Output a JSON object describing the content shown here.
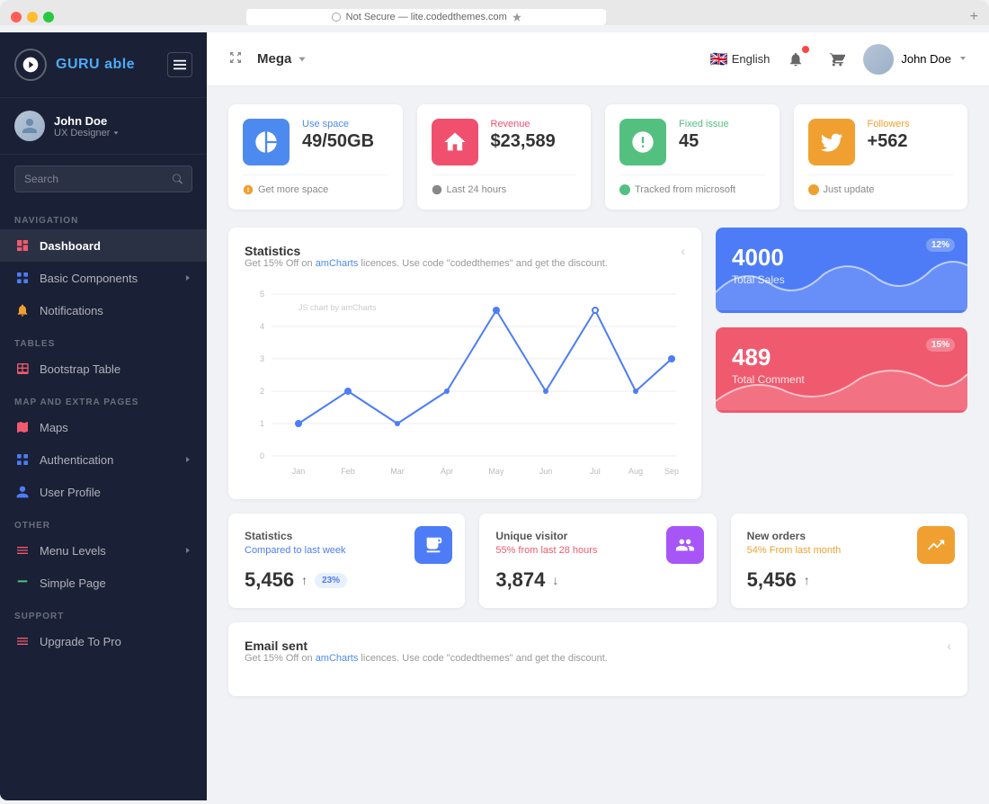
{
  "browser": {
    "url": "Not Secure — lite.codedthemes.com",
    "add_tab_label": "+"
  },
  "sidebar": {
    "brand": {
      "name_part1": "GURU",
      "name_part2": "able"
    },
    "user": {
      "name": "John Doe",
      "role": "UX Designer"
    },
    "search_placeholder": "Search",
    "sections": {
      "navigation": "Navigation",
      "tables": "Tables",
      "map_extra": "Map And Extra Pages",
      "other": "Other",
      "support": "Support"
    },
    "nav_items": [
      {
        "id": "dashboard",
        "label": "Dashboard",
        "active": true,
        "has_chevron": false
      },
      {
        "id": "basic-components",
        "label": "Basic Components",
        "active": false,
        "has_chevron": true
      },
      {
        "id": "notifications",
        "label": "Notifications",
        "active": false,
        "has_chevron": false
      },
      {
        "id": "bootstrap-table",
        "label": "Bootstrap Table",
        "active": false,
        "has_chevron": false
      },
      {
        "id": "maps",
        "label": "Maps",
        "active": false,
        "has_chevron": false
      },
      {
        "id": "authentication",
        "label": "Authentication",
        "active": false,
        "has_chevron": true
      },
      {
        "id": "user-profile",
        "label": "User Profile",
        "active": false,
        "has_chevron": false
      },
      {
        "id": "menu-levels",
        "label": "Menu Levels",
        "active": false,
        "has_chevron": true
      },
      {
        "id": "simple-page",
        "label": "Simple Page",
        "active": false,
        "has_chevron": false
      },
      {
        "id": "upgrade-pro",
        "label": "Upgrade To Pro",
        "active": false,
        "has_chevron": false
      }
    ]
  },
  "header": {
    "menu_label": "Mega",
    "language": "English",
    "user_name": "John Doe"
  },
  "stat_cards": [
    {
      "icon_color": "blue",
      "label": "Use space",
      "value": "49/50GB",
      "footer": "Get more space",
      "footer_color": "blue"
    },
    {
      "icon_color": "pink",
      "label": "Revenue",
      "value": "$23,589",
      "footer": "Last 24 hours",
      "footer_color": "pink"
    },
    {
      "icon_color": "green",
      "label": "Fixed issue",
      "value": "45",
      "footer": "Tracked from microsoft",
      "footer_color": "green"
    },
    {
      "icon_color": "orange",
      "label": "Followers",
      "value": "+562",
      "footer": "Just update",
      "footer_color": "orange"
    }
  ],
  "chart": {
    "title": "Statistics",
    "subtitle_plain": "Get 15% Off on ",
    "subtitle_link": "amCharts",
    "subtitle_rest": " licences. Use code \"codedthemes\" and get the discount.",
    "chart_label": "JS chart by amCharts",
    "x_labels": [
      "Jan",
      "Feb",
      "Mar",
      "Apr",
      "May",
      "Jun",
      "Jul",
      "Aug",
      "Sep"
    ],
    "y_labels": [
      "0",
      "1",
      "2",
      "3",
      "4",
      "5"
    ]
  },
  "side_cards": [
    {
      "color": "blue",
      "badge": "12%",
      "value": "4000",
      "label": "Total Sales"
    },
    {
      "color": "red",
      "badge": "15%",
      "value": "489",
      "label": "Total Comment"
    }
  ],
  "bottom_stats": [
    {
      "icon_color": "blue",
      "title": "Statistics",
      "subtitle": "Compared to last week",
      "subtitle_color": "blue",
      "value": "5,456",
      "trend": "up",
      "badge": "23%"
    },
    {
      "icon_color": "purple",
      "title": "Unique visitor",
      "subtitle": "55% from last 28 hours",
      "subtitle_color": "pink",
      "value": "3,874",
      "trend": "down",
      "badge": null
    },
    {
      "icon_color": "orange",
      "title": "New orders",
      "subtitle": "54% From last month",
      "subtitle_color": "orange",
      "value": "5,456",
      "trend": "up",
      "badge": null
    }
  ],
  "email_card": {
    "title": "Email sent",
    "subtitle_plain": "Get 15% Off on ",
    "subtitle_link": "amCharts",
    "subtitle_rest": " licences. Use code \"codedthemes\" and get the discount."
  }
}
